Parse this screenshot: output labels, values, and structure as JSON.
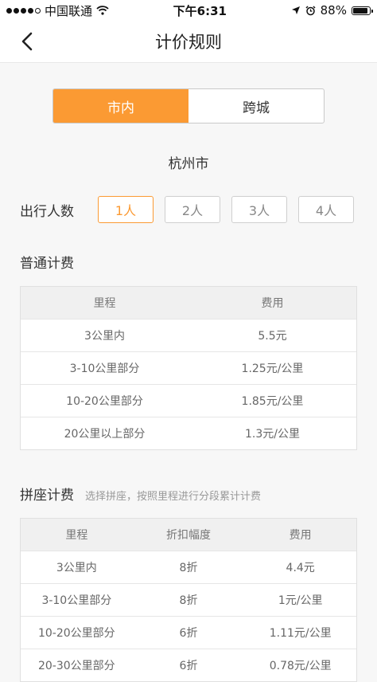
{
  "status": {
    "carrier": "中国联通",
    "time": "下午6:31",
    "battery": "88%",
    "battery_level": 0.88
  },
  "nav": {
    "title": "计价规则"
  },
  "tabs": [
    {
      "label": "市内",
      "active": true
    },
    {
      "label": "跨城",
      "active": false
    }
  ],
  "city": "杭州市",
  "people": {
    "label": "出行人数",
    "options": [
      "1人",
      "2人",
      "3人",
      "4人"
    ],
    "selected": 0
  },
  "normal": {
    "title": "普通计费",
    "headers": [
      "里程",
      "费用"
    ],
    "rows": [
      [
        "3公里内",
        "5.5元"
      ],
      [
        "3-10公里部分",
        "1.25元/公里"
      ],
      [
        "10-20公里部分",
        "1.85元/公里"
      ],
      [
        "20公里以上部分",
        "1.3元/公里"
      ]
    ]
  },
  "carpool": {
    "title": "拼座计费",
    "note": "选择拼座，按照里程进行分段累计计费",
    "headers": [
      "里程",
      "折扣幅度",
      "费用"
    ],
    "rows": [
      [
        "3公里内",
        "8折",
        "4.4元"
      ],
      [
        "3-10公里部分",
        "8折",
        "1元/公里"
      ],
      [
        "10-20公里部分",
        "6折",
        "1.11元/公里"
      ],
      [
        "20-30公里部分",
        "6折",
        "0.78元/公里"
      ]
    ]
  },
  "colors": {
    "accent": "#fb9a33"
  },
  "icons": {
    "back": "chevron-left-icon",
    "wifi": "wifi-icon",
    "location": "location-arrow-icon",
    "alarm": "alarm-icon",
    "battery": "battery-icon"
  }
}
